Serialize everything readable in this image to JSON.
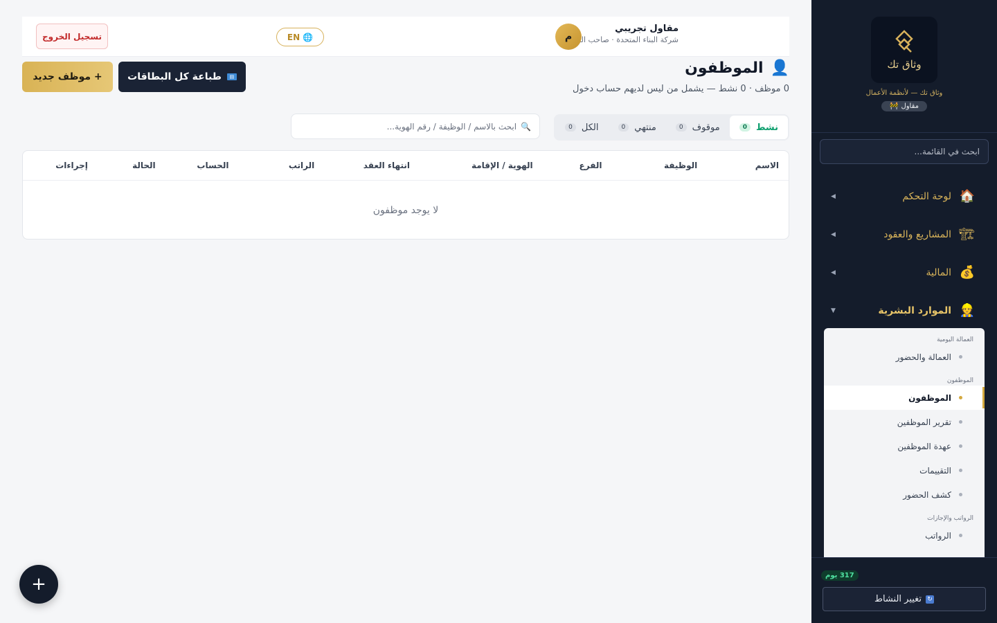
{
  "sidebar": {
    "logo_text": "وثاق تك",
    "tagline": "وثاق تك — لأنظمة الأعمال",
    "role_badge": "مقاول",
    "search_placeholder": "ابحث في القائمة...",
    "nav": [
      {
        "label": "لوحة التحكم",
        "icon": "house-icon"
      },
      {
        "label": "المشاريع والعقود",
        "icon": "construction-icon"
      },
      {
        "label": "المالية",
        "icon": "money-bag-icon"
      },
      {
        "label": "الموارد البشرية",
        "icon": "worker-icon"
      }
    ],
    "submenu": {
      "group1": "العمالة اليومية",
      "item1": "العمالة والحضور",
      "group2": "الموظفون",
      "item2": "الموظفون",
      "item3": "تقرير الموظفين",
      "item4": "عهدة الموظفين",
      "item5": "التقييمات",
      "item6": "كشف الحضور",
      "group3": "الرواتب والإجازات",
      "item7": "الرواتب"
    },
    "days_badge": "317 يوم",
    "change_activity": "تغيير النشاط"
  },
  "topbar": {
    "user_name": "مقاول تجريبي",
    "user_sub": "شركة البناء المتحدة · صاحب المنشأة",
    "avatar_letter": "م",
    "lang_label": "EN",
    "logout_label": "تسجيل الخروج"
  },
  "page": {
    "title": "الموظفون",
    "subtitle": "0 موظف · 0 نشط — يشمل من ليس لديهم حساب دخول",
    "new_button": "+ موظف جديد",
    "print_button": "طباعة كل البطاقات"
  },
  "filters": {
    "tabs": [
      {
        "label": "نشط",
        "count": "0"
      },
      {
        "label": "موقوف",
        "count": "0"
      },
      {
        "label": "منتهي",
        "count": "0"
      },
      {
        "label": "الكل",
        "count": "0"
      }
    ],
    "search_placeholder": "ابحث بالاسم / الوظيفة / رقم الهوية..."
  },
  "table": {
    "columns": [
      "الاسم",
      "الوظيفة",
      "الفرع",
      "الهوية / الإقامة",
      "انتهاء العقد",
      "الراتب",
      "الحساب",
      "الحالة",
      "إجراءات"
    ],
    "empty_text": "لا يوجد موظفون"
  },
  "colors": {
    "sidebar_bg": "#141c2b",
    "accent_gold": "#d9b355",
    "active_green": "#0e9f6e",
    "danger": "#c22b2b"
  }
}
